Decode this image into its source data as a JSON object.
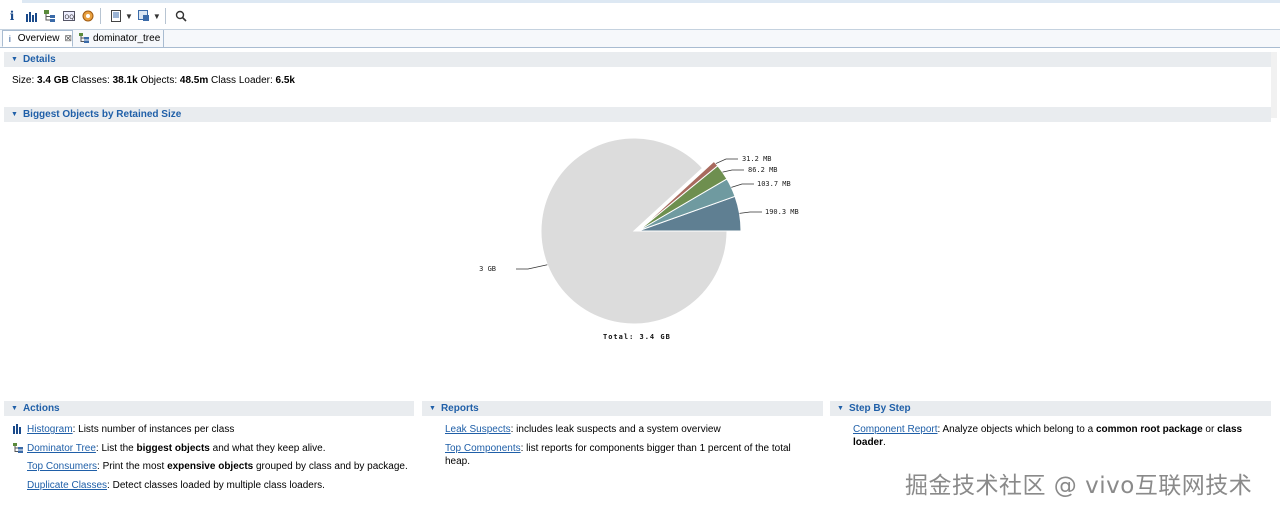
{
  "toolbar": {
    "icons": [
      "info-icon",
      "histogram-icon",
      "dominator-tree-icon",
      "oql-icon",
      "heap-dump-icon",
      "report-icon",
      "query-icon",
      "search-icon"
    ]
  },
  "tabs": [
    {
      "label": "Overview",
      "icon": "info-icon",
      "active": true
    },
    {
      "label": "dominator_tree",
      "icon": "dominator-tree-icon",
      "active": false
    }
  ],
  "details": {
    "title": "Details",
    "size_label": "Size:",
    "size_value": "3.4 GB",
    "classes_label": "Classes:",
    "classes_value": "38.1k",
    "objects_label": "Objects:",
    "objects_value": "48.5m",
    "loader_label": "Class Loader:",
    "loader_value": "6.5k"
  },
  "biggest": {
    "title": "Biggest Objects by Retained Size",
    "total": "Total: 3.4 GB"
  },
  "chart_data": {
    "type": "pie",
    "total_label": "Total: 3.4 GB",
    "slices": [
      {
        "label": "190.3 MB",
        "value": 190.3,
        "color": "#5f7f92"
      },
      {
        "label": "103.7 MB",
        "value": 103.7,
        "color": "#6f9aa0"
      },
      {
        "label": "86.2 MB",
        "value": 86.2,
        "color": "#6e8f4f"
      },
      {
        "label": "31.2 MB",
        "value": 31.2,
        "color": "#a86a5e"
      },
      {
        "label": "3 GB",
        "value": 3072,
        "color": "#dcdcdc"
      }
    ]
  },
  "actions": {
    "title": "Actions",
    "items": [
      {
        "link": "Histogram",
        "text": ": Lists number of instances per class",
        "icon": "histogram-icon"
      },
      {
        "link": "Dominator Tree",
        "pre": ": List the ",
        "bold": "biggest objects",
        "post": " and what they keep alive.",
        "icon": "dominator-tree-icon"
      },
      {
        "link": "Top Consumers",
        "pre": ": Print the most ",
        "bold": "expensive objects",
        "post": " grouped by class and by package."
      },
      {
        "link": "Duplicate Classes",
        "text": ": Detect classes loaded by multiple class loaders."
      }
    ]
  },
  "reports": {
    "title": "Reports",
    "items": [
      {
        "link": "Leak Suspects",
        "text": ": includes leak suspects and a system overview"
      },
      {
        "link": "Top Components",
        "text": ": list reports for components bigger than 1 percent of the total heap."
      }
    ]
  },
  "steps": {
    "title": "Step By Step",
    "item": {
      "link": "Component Report",
      "pre": ": Analyze objects which belong to a ",
      "bold1": "common root package",
      "mid": " or ",
      "bold2": "class loader",
      "post": "."
    }
  },
  "watermark": "掘金技术社区 @ vivo互联网技术"
}
